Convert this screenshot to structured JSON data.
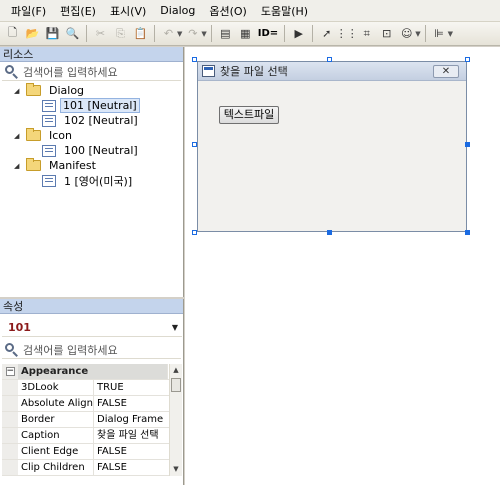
{
  "menu": [
    "파일(F)",
    "편집(E)",
    "표시(V)",
    "Dialog",
    "옵션(O)",
    "도움말(H)"
  ],
  "toolbar": {
    "id_label": "ID="
  },
  "resources_panel": {
    "title": "리소스",
    "search_placeholder": "검색어를 입력하세요",
    "tree": [
      {
        "label": "Dialog",
        "type": "folder",
        "expanded": true
      },
      {
        "label": "101 [Neutral]",
        "type": "dialog",
        "selected": true
      },
      {
        "label": "102 [Neutral]",
        "type": "dialog"
      },
      {
        "label": "Icon",
        "type": "folder",
        "expanded": true
      },
      {
        "label": "100 [Neutral]",
        "type": "icon"
      },
      {
        "label": "Manifest",
        "type": "folder",
        "expanded": true
      },
      {
        "label": "1 [영어(미국)]",
        "type": "manifest"
      }
    ]
  },
  "properties_panel": {
    "title": "속성",
    "selected_object": "101",
    "search_placeholder": "검색어를 입력하세요",
    "category": "Appearance",
    "rows": [
      {
        "name": "3DLook",
        "value": "TRUE"
      },
      {
        "name": "Absolute Align",
        "value": "FALSE"
      },
      {
        "name": "Border",
        "value": "Dialog Frame"
      },
      {
        "name": "Caption",
        "value": "찾을 파일 선택"
      },
      {
        "name": "Client Edge",
        "value": "FALSE"
      },
      {
        "name": "Clip Children",
        "value": "FALSE"
      }
    ]
  },
  "dialog": {
    "title": "찾을 파일 선택",
    "close_label": "✕",
    "button_label": "텍스트파일"
  },
  "colors": {
    "accent": "#1b6be2",
    "panel_header": "#c4d4ec",
    "selected_value": "#8b1a1a"
  }
}
